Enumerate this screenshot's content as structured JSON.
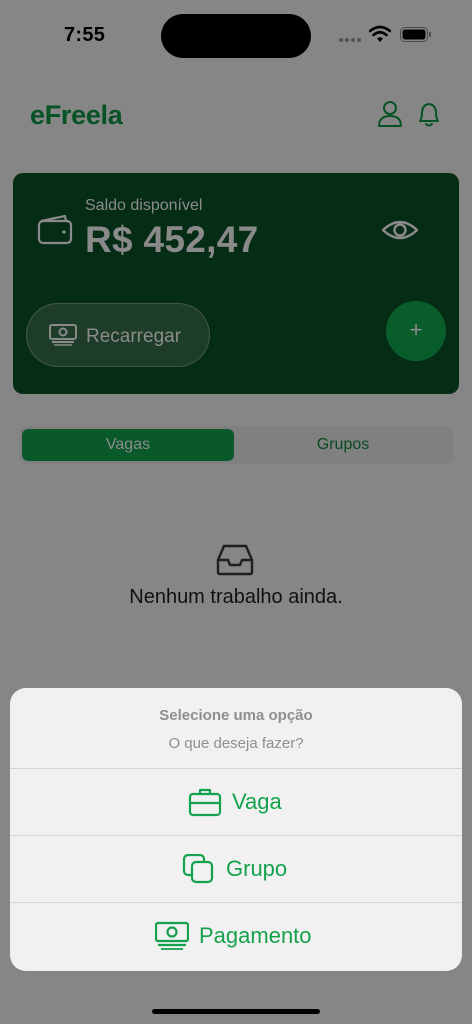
{
  "status_bar": {
    "time": "7:55"
  },
  "header": {
    "logo": "eFreela",
    "profile_icon": "user-icon",
    "notifications_icon": "bell-icon"
  },
  "balance_card": {
    "label": "Saldo disponível",
    "value": "R$ 452,47",
    "visibility_icon": "eye-icon",
    "recharge_label": "Recarregar",
    "add_label": "+"
  },
  "tabs": [
    {
      "label": "Vagas",
      "active": true
    },
    {
      "label": "Grupos",
      "active": false
    }
  ],
  "empty_state": {
    "icon": "inbox-icon",
    "message": "Nenhum trabalho ainda."
  },
  "action_sheet": {
    "title": "Selecione uma opção",
    "subtitle": "O que deseja fazer?",
    "options": [
      {
        "label": "Vaga",
        "icon": "briefcase-icon"
      },
      {
        "label": "Grupo",
        "icon": "copy-icon"
      },
      {
        "label": "Pagamento",
        "icon": "cash-icon"
      }
    ]
  },
  "colors": {
    "brand": "#0e9a45",
    "card": "#0b5227",
    "accent": "#12ad51"
  }
}
